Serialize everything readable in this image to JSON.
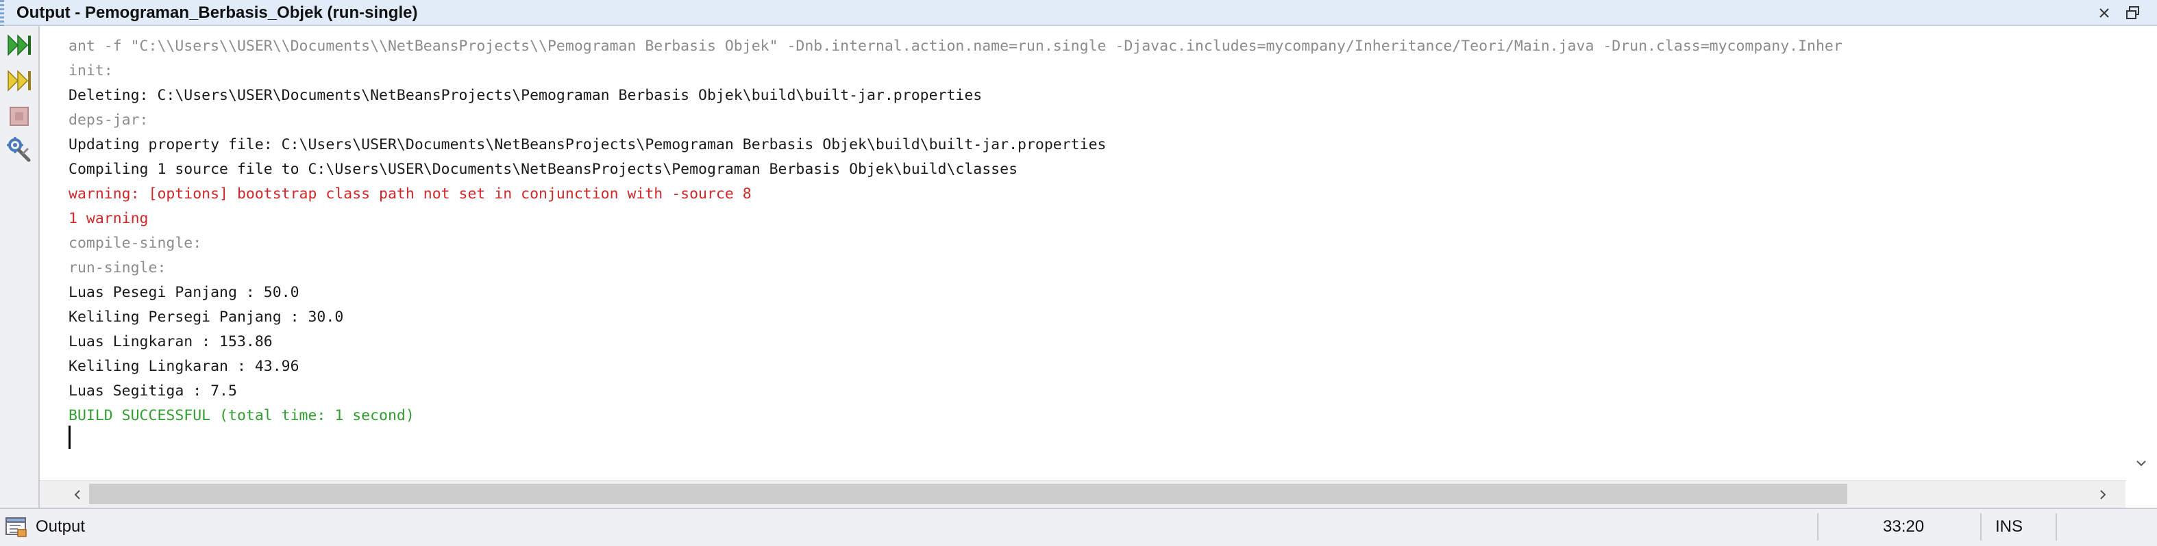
{
  "window": {
    "title": "Output - Pemograman_Berbasis_Objek (run-single)",
    "close_icon": "close-icon",
    "restore_icon": "restore-window-icon"
  },
  "toolbar": {
    "tools": [
      {
        "name": "rerun",
        "icon": "rerun-icon",
        "color": "#3aa63a"
      },
      {
        "name": "rerun-with-options",
        "icon": "rerun-with-options-icon",
        "color": "#d9b521"
      },
      {
        "name": "stop",
        "icon": "stop-icon",
        "color": "#d99a9a"
      },
      {
        "name": "settings",
        "icon": "settings-icon",
        "color": "#4a7ab8"
      }
    ]
  },
  "output": {
    "lines": [
      {
        "text": "ant -f \"C:\\\\Users\\\\USER\\\\Documents\\\\NetBeansProjects\\\\Pemograman Berbasis Objek\" -Dnb.internal.action.name=run.single -Djavac.includes=mycompany/Inheritance/Teori/Main.java -Drun.class=mycompany.Inher",
        "kind": "gray"
      },
      {
        "text": "init:",
        "kind": "gray"
      },
      {
        "text": "Deleting: C:\\Users\\USER\\Documents\\NetBeansProjects\\Pemograman Berbasis Objek\\build\\built-jar.properties",
        "kind": "black"
      },
      {
        "text": "deps-jar:",
        "kind": "gray"
      },
      {
        "text": "Updating property file: C:\\Users\\USER\\Documents\\NetBeansProjects\\Pemograman Berbasis Objek\\build\\built-jar.properties",
        "kind": "black"
      },
      {
        "text": "Compiling 1 source file to C:\\Users\\USER\\Documents\\NetBeansProjects\\Pemograman Berbasis Objek\\build\\classes",
        "kind": "black"
      },
      {
        "text": "warning: [options] bootstrap class path not set in conjunction with -source 8",
        "kind": "red"
      },
      {
        "text": "1 warning",
        "kind": "red"
      },
      {
        "text": "compile-single:",
        "kind": "gray"
      },
      {
        "text": "run-single:",
        "kind": "gray"
      },
      {
        "text": "Luas Pesegi Panjang : 50.0",
        "kind": "black"
      },
      {
        "text": "Keliling Persegi Panjang : 30.0",
        "kind": "black"
      },
      {
        "text": "Luas Lingkaran : 153.86",
        "kind": "black"
      },
      {
        "text": "Keliling Lingkaran : 43.96",
        "kind": "black"
      },
      {
        "text": "Luas Segitiga : 7.5",
        "kind": "black"
      },
      {
        "text": "BUILD SUCCESSFUL (total time: 1 second)",
        "kind": "green"
      }
    ]
  },
  "colors": {
    "gray": "#8c8c8c",
    "black": "#1a1a1a",
    "red": "#d0282a",
    "green": "#2f9e2f"
  },
  "scrollbars": {
    "left_arrow_icon": "chevron-left-icon",
    "right_arrow_icon": "chevron-right-icon",
    "down_arrow_icon": "chevron-down-icon"
  },
  "statusbar": {
    "label": "Output",
    "icon": "output-window-icon",
    "caret_position": "33:20",
    "insert_mode": "INS"
  }
}
